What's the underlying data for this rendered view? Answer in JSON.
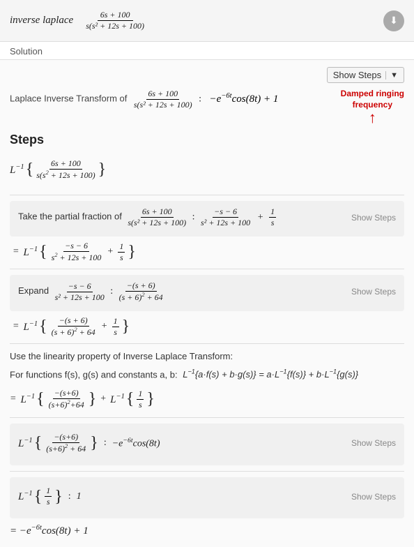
{
  "header": {
    "formula_label": "inverse laplace",
    "download_icon": "⬇",
    "formula_fraction_num": "6s + 100",
    "formula_fraction_den": "s(s² + 12s + 100)"
  },
  "solution": {
    "section_label": "Solution",
    "show_steps_button": "Show Steps",
    "laplace_prefix": "Laplace Inverse Transform of",
    "laplace_frac_num": "6s + 100",
    "laplace_frac_den": "s(s² + 12s + 100)",
    "laplace_result": "−e⁻⁶ᵗcos(8t) + 1",
    "annotation": {
      "text_line1": "Damped ringing",
      "text_line2": "frequency",
      "arrow": "↑"
    },
    "steps_header": "Steps",
    "step0": {
      "math": "L⁻¹{ (6s+100) / (s(s²+12s+100)) }"
    },
    "step1": {
      "desc_prefix": "Take the partial fraction of",
      "desc_frac_num": "6s + 100",
      "desc_frac_den": "s(s² + 12s + 100)",
      "result_part1_num": "−s − 6",
      "result_part1_den": "s² + 12s + 100",
      "result_plus": "+",
      "result_part2": "1/s",
      "show_steps": "Show Steps"
    },
    "step1_eq": "= L⁻¹{ (−s−6)/(s²+12s+100) + 1/s }",
    "step2": {
      "desc_prefix": "Expand",
      "desc_frac_num": "−s − 6",
      "desc_frac_den": "s² + 12s + 100",
      "result_num": "−(s + 6)",
      "result_den": "(s + 6)² + 64",
      "show_steps": "Show Steps"
    },
    "step2_eq": "= L⁻¹{ −(s+6)/((s+6)²+64) + 1/s }",
    "linearity_title": "Use the linearity property of Inverse Laplace Transform:",
    "linearity_desc": "For functions f(s), g(s) and constants a, b:",
    "linearity_formula": "L⁻¹{a·f(s) + b·g(s)} = a·L⁻¹{f(s)} + b·L⁻¹{g(s)}",
    "linearity_result": "= L⁻¹{ −(s+6)/((s+6)²+64) } + L⁻¹{ 1/s }",
    "step3": {
      "input_num": "−(s+6)",
      "input_den": "(s+6)² + 64",
      "result": "−e⁻⁶ᵗcos(8t)",
      "show_steps": "Show Steps"
    },
    "step4": {
      "input": "1/s",
      "result": "1",
      "show_steps": "Show Steps"
    },
    "final": "= −e⁻⁶ᵗcos(8t) + 1"
  }
}
